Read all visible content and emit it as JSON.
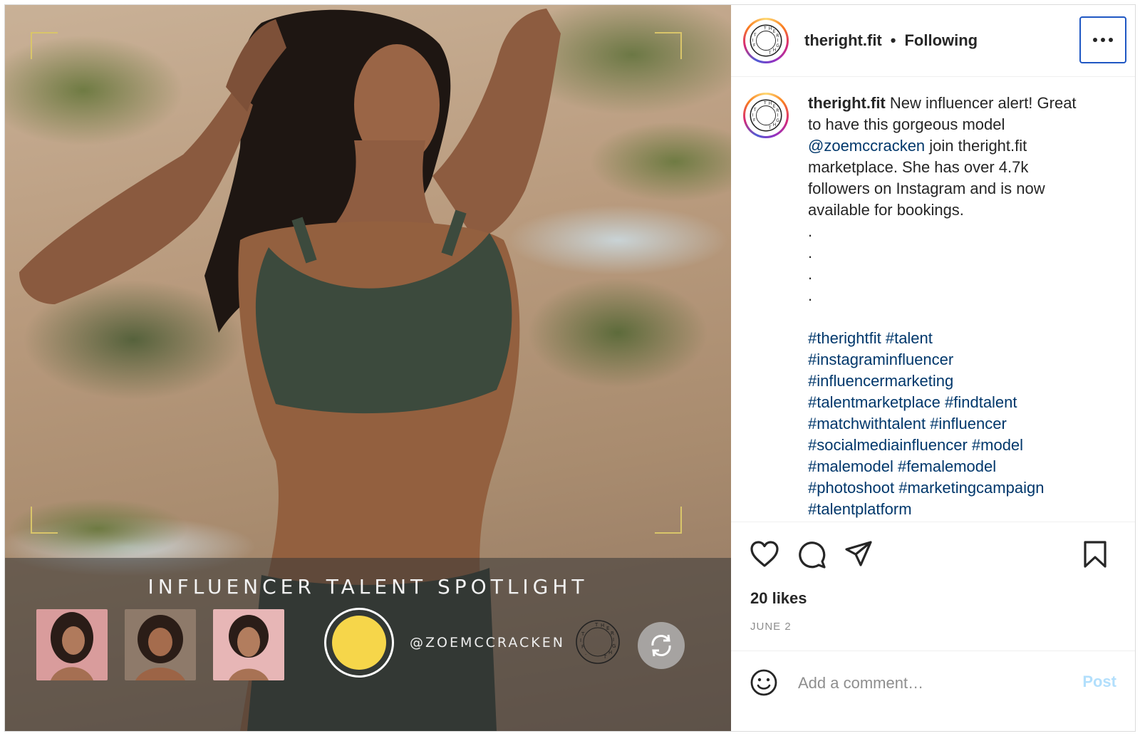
{
  "post": {
    "username": "theright.fit",
    "follow_status": "Following",
    "separator": "•",
    "more_label": "More options"
  },
  "caption": {
    "username": "theright.fit",
    "text_1": " New influencer alert! Great to have this gorgeous model ",
    "mention": "@zoemccracken",
    "text_2": " join theright.fit marketplace. She has over 4.7k followers on Instagram and is now available for bookings.",
    "dots": [
      ".",
      ".",
      ".",
      "."
    ],
    "hashtag_lines": [
      "#therightfit #talent",
      "#instagraminfluencer",
      "#influencermarketing",
      "#talentmarketplace #findtalent",
      "#matchwithtalent #influencer",
      "#socialmediainfluencer #model",
      "#malemodel #femalemodel",
      "#photoshoot #marketingcampaign",
      "#talentplatform"
    ]
  },
  "media_overlay": {
    "headline": "INFLUENCER TALENT SPOTLIGHT",
    "handle": "@ZOEMCCRACKEN"
  },
  "stats": {
    "likes": "20 likes",
    "date": "JUNE 2"
  },
  "comment": {
    "placeholder": "Add a comment…",
    "post_label": "Post"
  },
  "colors": {
    "link": "#00376b",
    "accent_border": "#1f57c3",
    "post_disabled": "#b2dffc",
    "shutter": "#f6d64a"
  },
  "icons": [
    "heart-icon",
    "comment-icon",
    "share-icon",
    "bookmark-icon",
    "emoji-icon",
    "more-icon",
    "flip-camera-icon"
  ]
}
